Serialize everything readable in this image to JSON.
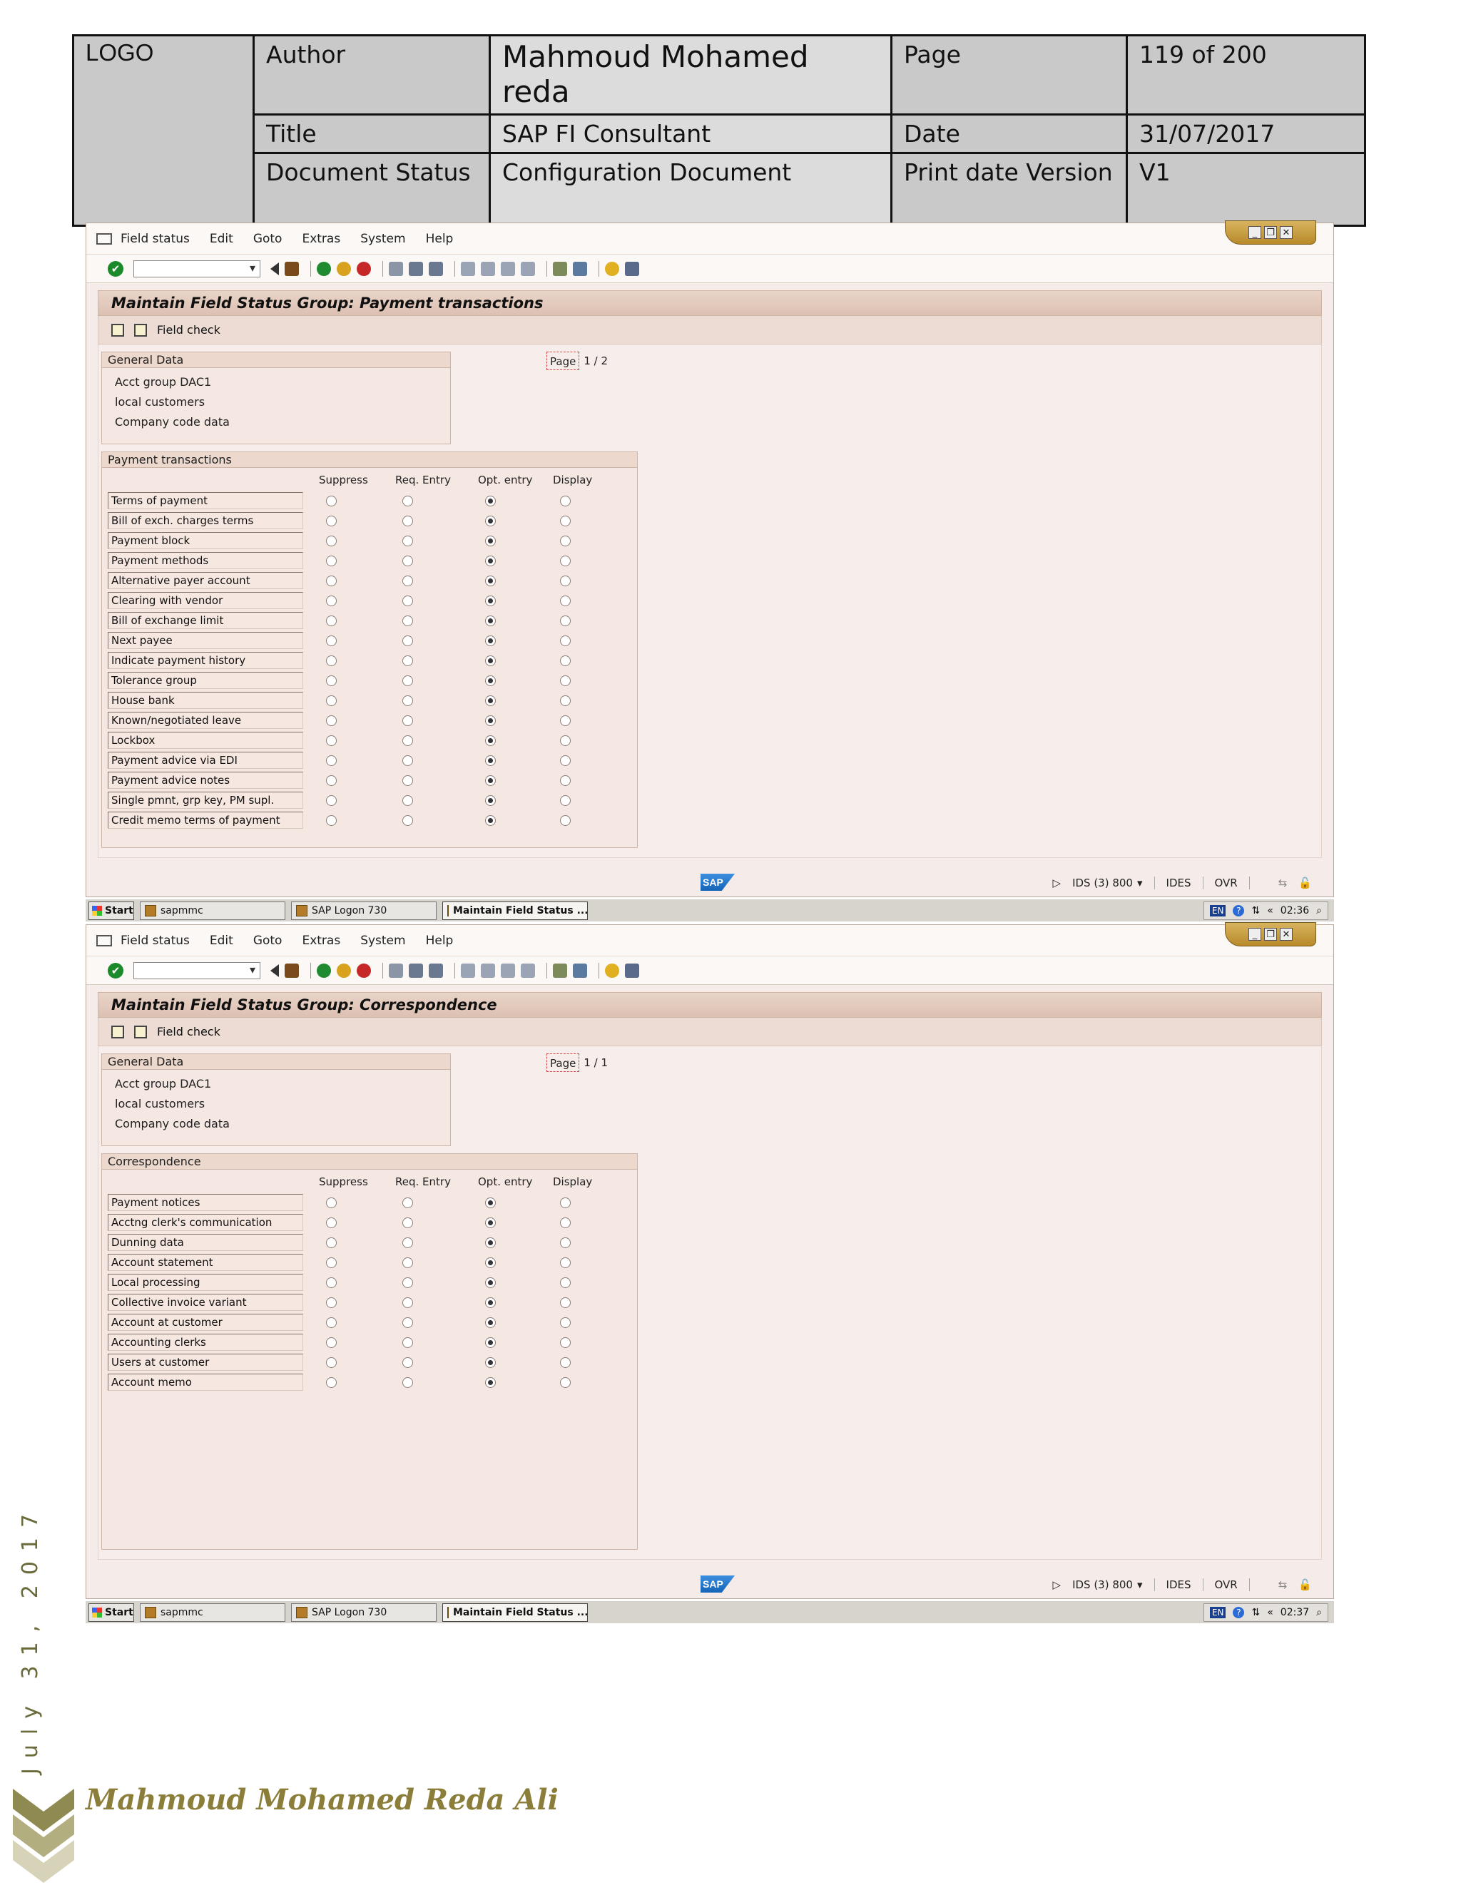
{
  "doc_header": {
    "logo": "LOGO",
    "author_label": "Author",
    "author_value": "Mahmoud Mohamed reda",
    "page_label": "Page",
    "page_value": "119 of 200",
    "title_label": "Title",
    "title_value": "SAP FI Consultant",
    "date_label": "Date",
    "date_value": "31/07/2017",
    "status_label": "Document Status",
    "status_value": "Configuration Document",
    "print_label": "Print date Version",
    "print_value": "V1"
  },
  "menu": [
    "Field status",
    "Edit",
    "Goto",
    "Extras",
    "System",
    "Help"
  ],
  "app_toolbar": {
    "field_check": "Field check"
  },
  "general_data": {
    "title": "General Data",
    "lines": [
      "Acct group   DAC1",
      "local customers",
      "Company code data"
    ]
  },
  "columns": [
    "Suppress",
    "Req. Entry",
    "Opt. entry",
    "Display"
  ],
  "status": {
    "system": "IDS (3) 800",
    "client": "IDES",
    "mode": "OVR"
  },
  "taskbar": {
    "start": "Start",
    "items": [
      "sapmmc",
      "SAP Logon 730",
      "Maintain Field Status ..."
    ],
    "lang": "EN"
  },
  "screens": [
    {
      "title": "Maintain Field Status Group: Payment transactions",
      "page": {
        "label": "Page",
        "current": "1",
        "sep": "/",
        "total": "2"
      },
      "group_title": "Payment transactions",
      "rows": [
        {
          "label": "Terms of payment",
          "selected": 2
        },
        {
          "label": "Bill of exch. charges terms",
          "selected": 2
        },
        {
          "label": "Payment block",
          "selected": 2
        },
        {
          "label": "Payment methods",
          "selected": 2
        },
        {
          "label": "Alternative payer account",
          "selected": 2
        },
        {
          "label": "Clearing with vendor",
          "selected": 2
        },
        {
          "label": "Bill of exchange limit",
          "selected": 2
        },
        {
          "label": "Next payee",
          "selected": 2
        },
        {
          "label": "Indicate payment history",
          "selected": 2
        },
        {
          "label": "Tolerance group",
          "selected": 2
        },
        {
          "label": "House bank",
          "selected": 2
        },
        {
          "label": "Known/negotiated leave",
          "selected": 2
        },
        {
          "label": "Lockbox",
          "selected": 2
        },
        {
          "label": "Payment advice via EDI",
          "selected": 2
        },
        {
          "label": "Payment advice notes",
          "selected": 2
        },
        {
          "label": "Single pmnt, grp key, PM supl.",
          "selected": 2
        },
        {
          "label": "Credit memo terms of payment",
          "selected": 2
        }
      ],
      "time": "02:36"
    },
    {
      "title": "Maintain Field Status Group: Correspondence",
      "page": {
        "label": "Page",
        "current": "1",
        "sep": "/",
        "total": "1"
      },
      "group_title": "Correspondence",
      "rows": [
        {
          "label": "Payment notices",
          "selected": 2
        },
        {
          "label": "Acctng clerk's communication",
          "selected": 2
        },
        {
          "label": "Dunning data",
          "selected": 2
        },
        {
          "label": "Account statement",
          "selected": 2
        },
        {
          "label": "Local processing",
          "selected": 2
        },
        {
          "label": "Collective invoice variant",
          "selected": 2
        },
        {
          "label": "Account at customer",
          "selected": 2
        },
        {
          "label": "Accounting clerks",
          "selected": 2
        },
        {
          "label": "Users at customer",
          "selected": 2
        },
        {
          "label": "Account memo",
          "selected": 2
        }
      ],
      "time": "02:37"
    }
  ],
  "footer": {
    "side_date": "July 31, 2017",
    "name": "Mahmoud Mohamed Reda Ali"
  }
}
